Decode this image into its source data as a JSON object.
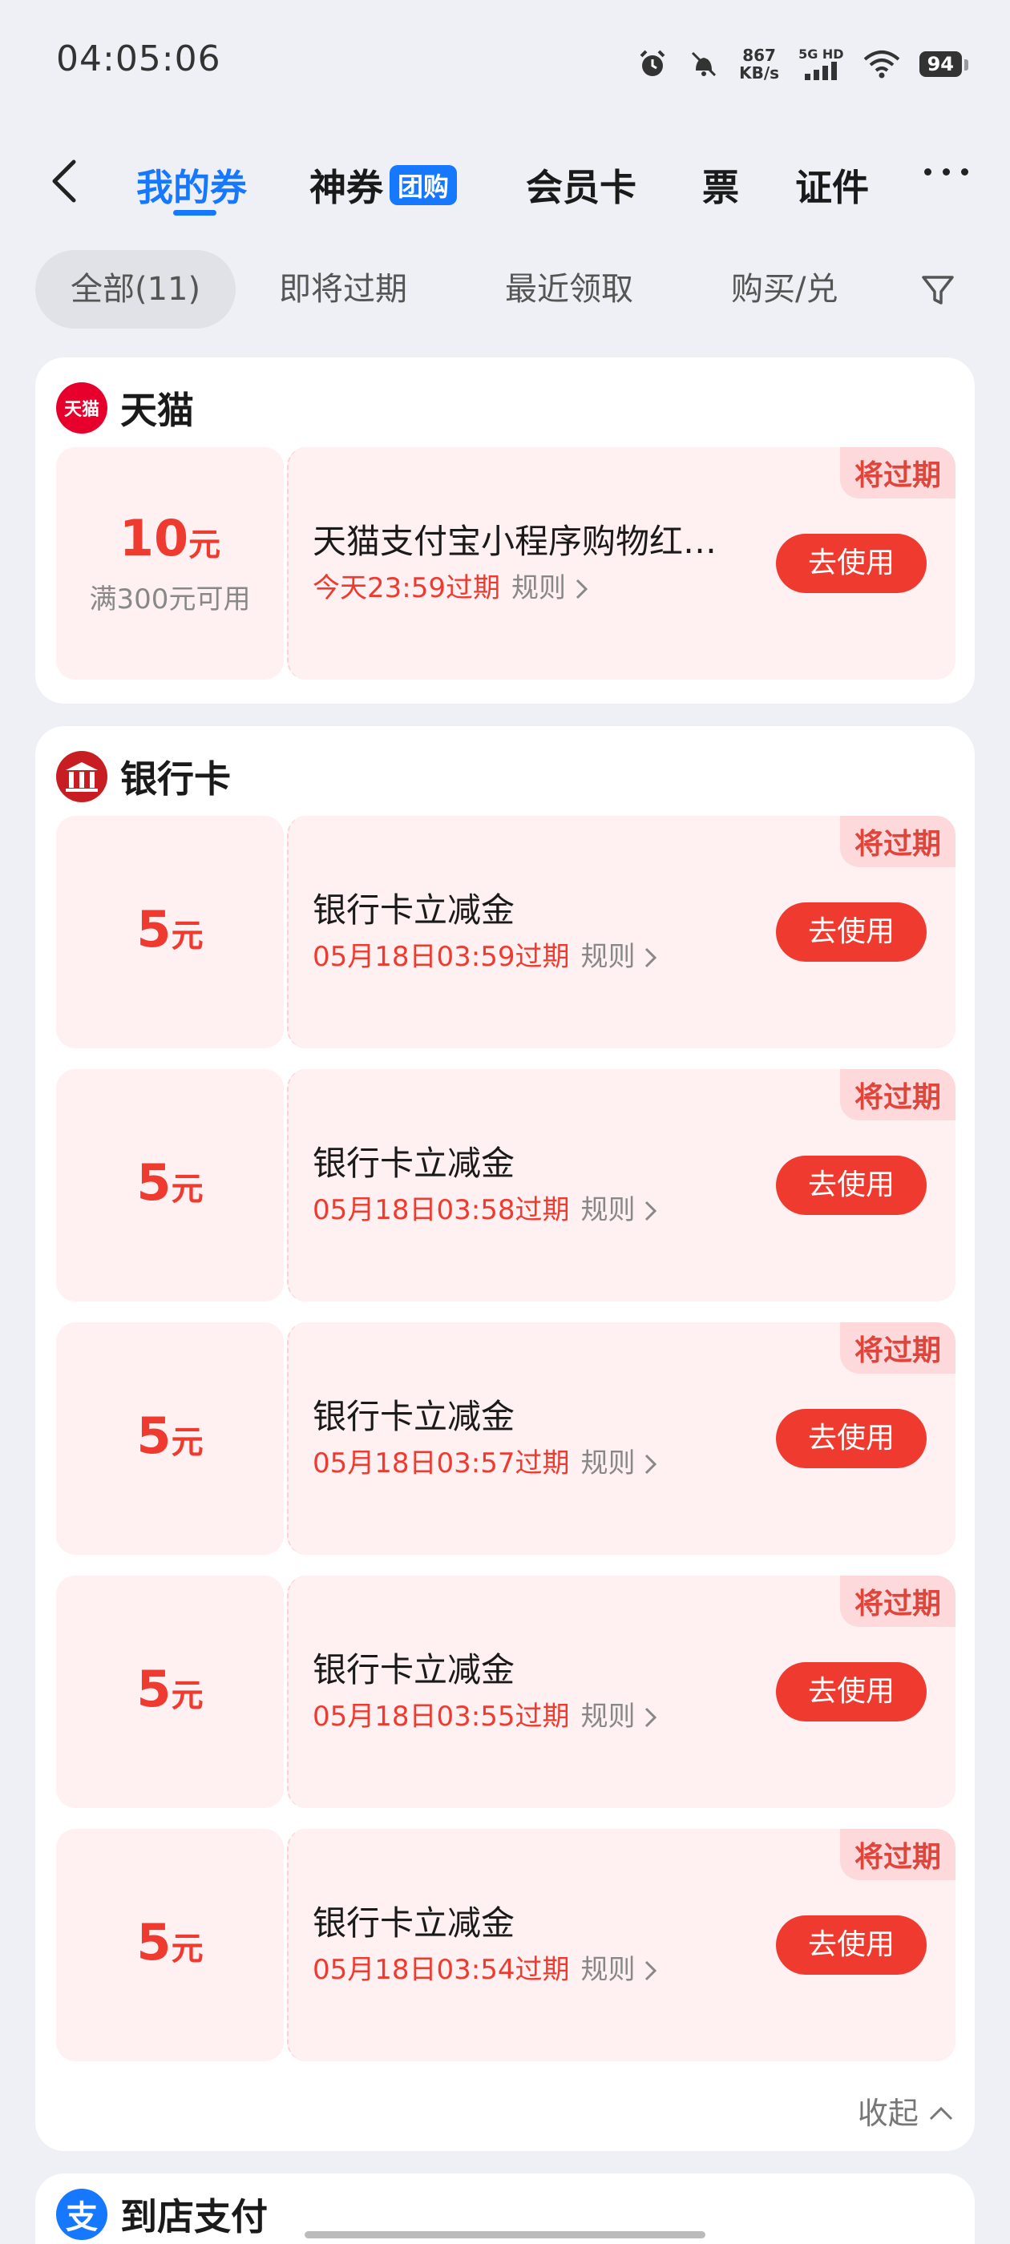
{
  "status_bar": {
    "time": "04:05:06",
    "net_speed_value": "867",
    "net_speed_unit": "KB/s",
    "signal_label": "5G HD",
    "battery": "94"
  },
  "nav": {
    "tabs": [
      {
        "label": "我的券",
        "active": true
      },
      {
        "label": "神券",
        "badge": "团购"
      },
      {
        "label": "会员卡"
      },
      {
        "label": "票"
      },
      {
        "label": "证件"
      }
    ]
  },
  "filters": {
    "chips": [
      "全部(11)",
      "即将过期",
      "最近领取",
      "购买/兑"
    ]
  },
  "colors": {
    "accent": "#1677ff",
    "coupon_red": "#ef3b2f",
    "coupon_bg": "#fff0f1"
  },
  "sections": {
    "tmall": {
      "title": "天猫",
      "logo_text": "天猫",
      "coupons": [
        {
          "amount": "10",
          "unit": "元",
          "condition": "满300元可用",
          "title": "天猫支付宝小程序购物红…",
          "expire": "今天23:59过期",
          "rule": "规则",
          "button": "去使用",
          "tag": "将过期"
        }
      ]
    },
    "bank": {
      "title": "银行卡",
      "coupons": [
        {
          "amount": "5",
          "unit": "元",
          "title": "银行卡立减金",
          "expire": "05月18日03:59过期",
          "rule": "规则",
          "button": "去使用",
          "tag": "将过期"
        },
        {
          "amount": "5",
          "unit": "元",
          "title": "银行卡立减金",
          "expire": "05月18日03:58过期",
          "rule": "规则",
          "button": "去使用",
          "tag": "将过期"
        },
        {
          "amount": "5",
          "unit": "元",
          "title": "银行卡立减金",
          "expire": "05月18日03:57过期",
          "rule": "规则",
          "button": "去使用",
          "tag": "将过期"
        },
        {
          "amount": "5",
          "unit": "元",
          "title": "银行卡立减金",
          "expire": "05月18日03:55过期",
          "rule": "规则",
          "button": "去使用",
          "tag": "将过期"
        },
        {
          "amount": "5",
          "unit": "元",
          "title": "银行卡立减金",
          "expire": "05月18日03:54过期",
          "rule": "规则",
          "button": "去使用",
          "tag": "将过期"
        }
      ],
      "collapse_label": "收起"
    },
    "store_pay": {
      "title": "到店支付"
    }
  }
}
